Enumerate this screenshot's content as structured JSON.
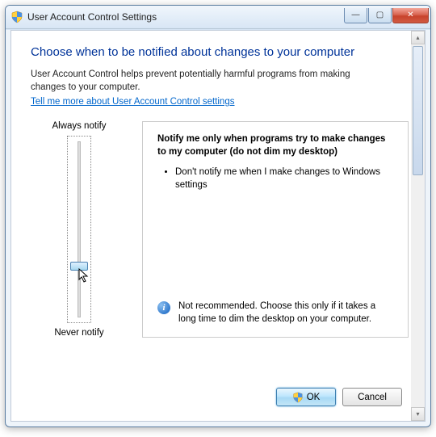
{
  "window": {
    "title": "User Account Control Settings"
  },
  "content": {
    "heading": "Choose when to be notified about changes to your computer",
    "description": "User Account Control helps prevent potentially harmful programs from making changes to your computer.",
    "help_link": "Tell me more about User Account Control settings"
  },
  "slider": {
    "top_label": "Always notify",
    "bottom_label": "Never notify",
    "levels": 4,
    "current_level": 1
  },
  "detail": {
    "title": "Notify me only when programs try to make changes to my computer (do not dim my desktop)",
    "bullets": [
      "Don't notify me when I make changes to Windows settings"
    ],
    "warning": "Not recommended. Choose this only if it takes a long time to dim the desktop on your computer."
  },
  "buttons": {
    "ok": "OK",
    "cancel": "Cancel"
  }
}
